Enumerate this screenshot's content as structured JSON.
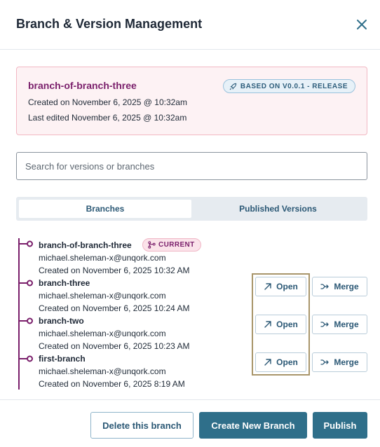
{
  "dialog": {
    "title": "Branch & Version Management"
  },
  "info_card": {
    "branch_name": "branch-of-branch-three",
    "badge": "BASED ON V0.0.1 - RELEASE",
    "created": "Created on November 6, 2025 @ 10:32am",
    "edited": "Last edited November 6, 2025 @ 10:32am"
  },
  "search": {
    "placeholder": "Search for versions or branches",
    "value": ""
  },
  "tabs": [
    {
      "label": "Branches",
      "active": true
    },
    {
      "label": "Published Versions",
      "active": false
    }
  ],
  "branches": [
    {
      "name": "branch-of-branch-three",
      "user": "michael.sheleman-x@unqork.com",
      "created": "Created on November 6, 2025 10:32 AM",
      "current_label": "CURRENT"
    },
    {
      "name": "branch-three",
      "user": "michael.sheleman-x@unqork.com",
      "created": "Created on November 6, 2025 10:24 AM",
      "open_label": "Open",
      "merge_label": "Merge"
    },
    {
      "name": "branch-two",
      "user": "michael.sheleman-x@unqork.com",
      "created": "Created on November 6, 2025 10:23 AM",
      "open_label": "Open",
      "merge_label": "Merge"
    },
    {
      "name": "first-branch",
      "user": "michael.sheleman-x@unqork.com",
      "created": "Created on November 6, 2025 8:19 AM",
      "open_label": "Open",
      "merge_label": "Merge"
    }
  ],
  "footer": {
    "delete_label": "Delete this branch",
    "create_label": "Create New Branch",
    "publish_label": "Publish"
  },
  "colors": {
    "primary": "#2f6f8a",
    "branch_accent": "#7a1f6b",
    "card_bg": "#fdf2f4"
  },
  "icons": {
    "close": "close-icon",
    "badge": "rocket-icon",
    "current": "branch-icon",
    "open": "arrow-up-right-icon",
    "merge": "merge-icon"
  }
}
